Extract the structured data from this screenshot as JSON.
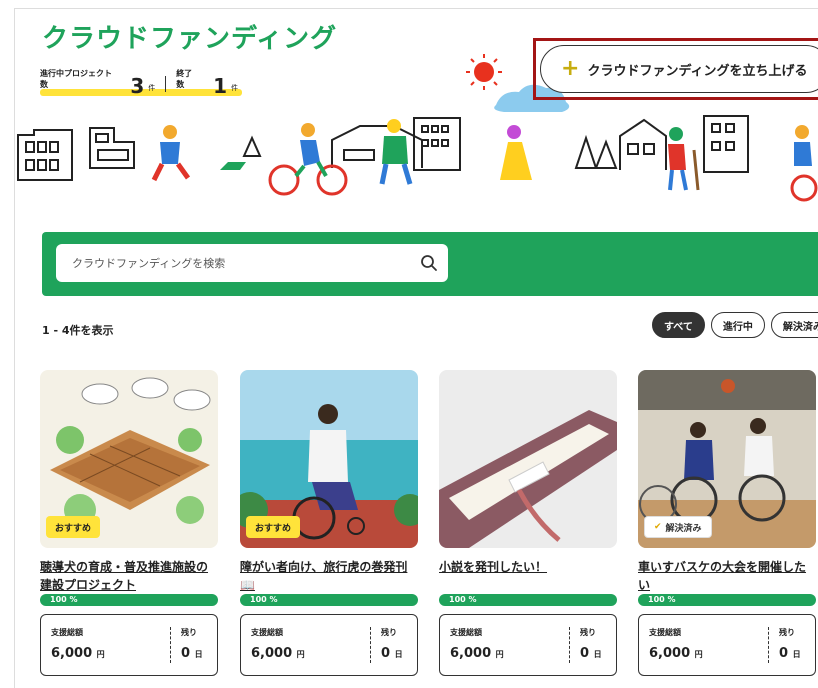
{
  "header": {
    "title": "クラウドファンディング",
    "stats": {
      "ongoing_label": "進行中プロジェクト数",
      "ongoing_value": "3",
      "ongoing_unit": "件",
      "finished_label": "終了数",
      "finished_value": "1",
      "finished_unit": "件"
    },
    "launch_button": "クラウドファンディングを立ち上げる"
  },
  "search": {
    "placeholder": "クラウドファンディングを検索"
  },
  "results": {
    "count_text": "1 - 4件を表示"
  },
  "filters": [
    {
      "label": "すべて",
      "active": true
    },
    {
      "label": "進行中",
      "active": false
    },
    {
      "label": "解決済み",
      "active": false
    }
  ],
  "cards": [
    {
      "title": "聴導犬の育成・普及推進施設の建設プロジェクト",
      "badge": "おすすめ",
      "progress": "100 %",
      "total_label": "支援総額",
      "total_value": "6,000",
      "total_unit": "円",
      "remain_label": "残り",
      "remain_value": "0",
      "remain_unit": "日"
    },
    {
      "title": "障がい者向け、旅行虎の巻発刊📖",
      "badge": "おすすめ",
      "progress": "100 %",
      "total_label": "支援総額",
      "total_value": "6,000",
      "total_unit": "円",
      "remain_label": "残り",
      "remain_value": "0",
      "remain_unit": "日"
    },
    {
      "title": "小説を発刊したい！",
      "badge": "",
      "progress": "100 %",
      "total_label": "支援総額",
      "total_value": "6,000",
      "total_unit": "円",
      "remain_label": "残り",
      "remain_value": "0",
      "remain_unit": "日"
    },
    {
      "title": "車いすバスケの大会を開催したい",
      "badge": "解決済み",
      "progress": "100 %",
      "total_label": "支援総額",
      "total_value": "6,000",
      "total_unit": "円",
      "remain_label": "残り",
      "remain_value": "0",
      "remain_unit": "日"
    }
  ],
  "colors": {
    "brand_green": "#1fa35b",
    "highlight_yellow": "#ffe33a",
    "focus_outline": "#a31515"
  }
}
